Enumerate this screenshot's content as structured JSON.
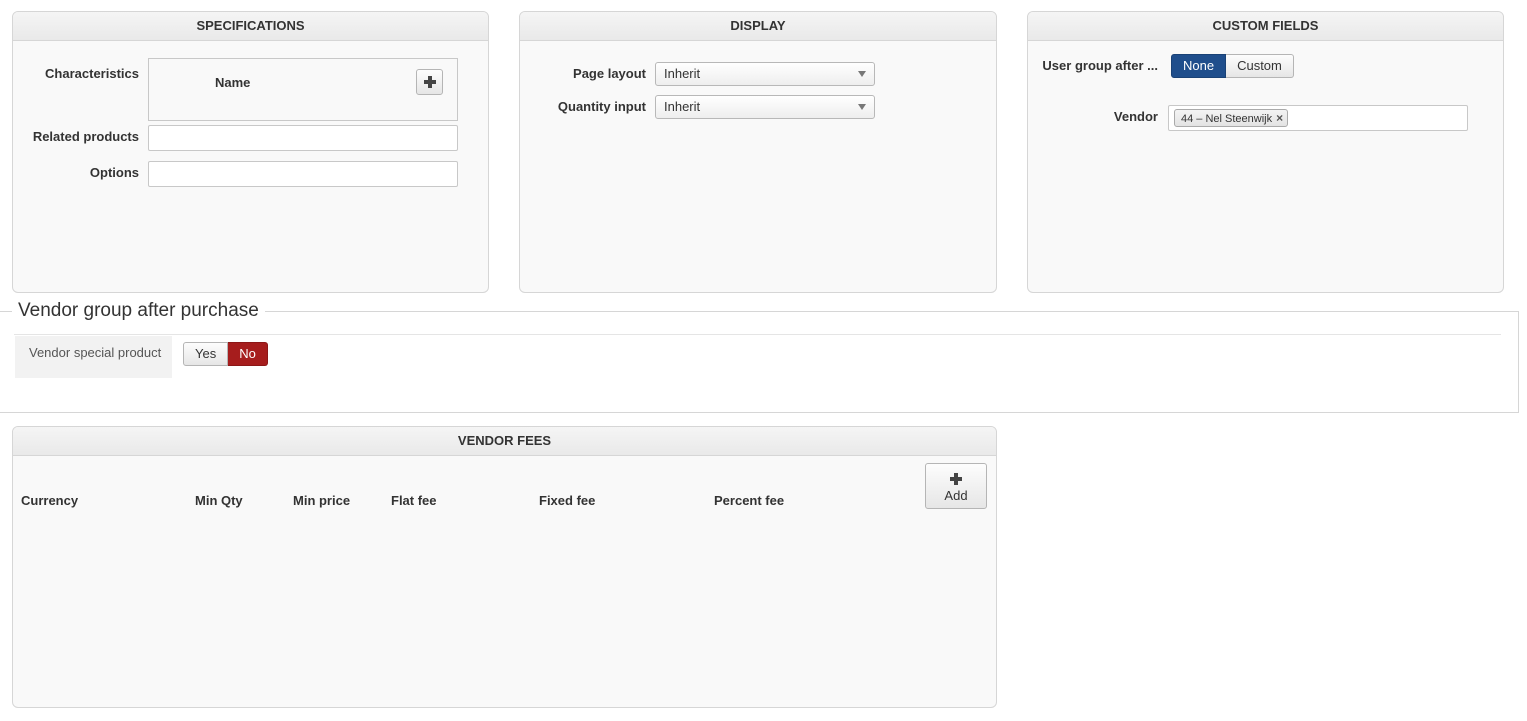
{
  "specifications": {
    "title": "SPECIFICATIONS",
    "characteristics_label": "Characteristics",
    "name_column": "Name",
    "related_products_label": "Related products",
    "options_label": "Options"
  },
  "display": {
    "title": "DISPLAY",
    "page_layout_label": "Page layout",
    "page_layout_value": "Inherit",
    "quantity_input_label": "Quantity input",
    "quantity_input_value": "Inherit"
  },
  "custom_fields": {
    "title": "CUSTOM FIELDS",
    "user_group_label": "User group after ...",
    "user_group_options": [
      "None",
      "Custom"
    ],
    "user_group_selected": "None",
    "vendor_label": "Vendor",
    "vendor_chip": "44 – Nel Steenwijk"
  },
  "vendor_group": {
    "legend": "Vendor group after purchase",
    "special_product_label": "Vendor special product",
    "options": [
      "Yes",
      "No"
    ],
    "selected": "No"
  },
  "vendor_fees": {
    "title": "VENDOR FEES",
    "columns": [
      "Currency",
      "Min Qty",
      "Min price",
      "Flat fee",
      "Fixed fee",
      "Percent fee"
    ],
    "add_label": "Add"
  },
  "colors": {
    "active_blue": "#1f4e8c",
    "active_red": "#a61d1d"
  }
}
